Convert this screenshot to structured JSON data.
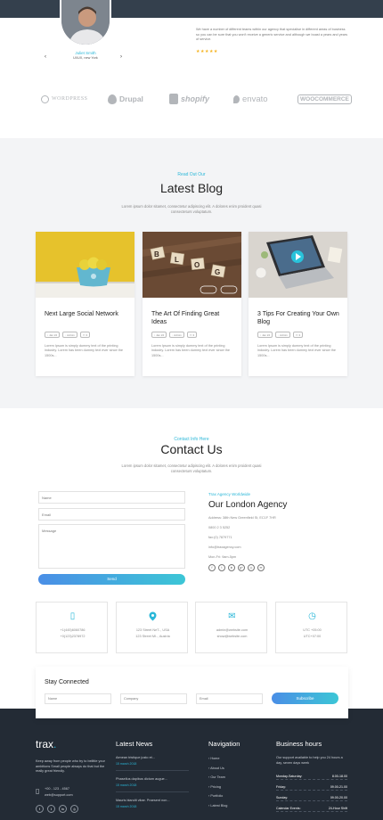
{
  "testimonial": {
    "name": "Juliet Smith",
    "role": "UI/UX, new York",
    "prev_arrow": "‹",
    "next_arrow": "›",
    "quote": "We have a number of different teams within our agency that specialise in different areas of business so you can be sure that you won't receive a generic service and although we boast a years and years of service.",
    "stars": "★★★★★",
    "rating": 5
  },
  "brands": [
    "WordPress",
    "Drupal",
    "shopify",
    "envato",
    "WooCommerce"
  ],
  "blog": {
    "subtitle": "Read Out Our",
    "title": "Latest Blog",
    "description": "Lorem ipsum dolor sitamet, consectetur adipiscing elit. A dolores enim proident quasi consecteturs voluptatum.",
    "posts": [
      {
        "title": "Next Large Social Network",
        "meta": [
          "Jan 24",
          "Admin",
          "3"
        ],
        "excerpt": "Lorem Ipsum is simply dummy text of the printing industry. Lorem has been dummy text ever since the 1500s..."
      },
      {
        "title": "The Art Of Finding Great Ideas",
        "meta": [
          "Jan 24",
          "Admin",
          "3"
        ],
        "excerpt": "Lorem Ipsum is simply dummy text of the printing industry. Lorem has been dummy text ever since the 1500s..."
      },
      {
        "title": "3 Tips For Creating Your Own Blog",
        "meta": [
          "Jan 24",
          "Admin",
          "3"
        ],
        "excerpt": "Lorem Ipsum is simply dummy text of the printing industry. Lorem has been dummy text ever since the 1500s..."
      }
    ]
  },
  "contact": {
    "subtitle": "Contact Info Here",
    "title": "Contact Us",
    "description": "Lorem ipsum dolor sitamet, consectetur adipiscing elit. A dolores enim proident quasi consecteturs voluptatum.",
    "form": {
      "name_placeholder": "Name",
      "email_placeholder": "Email",
      "message_placeholder": "Message",
      "send_label": "Send"
    },
    "agency": {
      "subtitle": "Trax Agency Worldwide",
      "title": "Our London Agency",
      "address": "Address: 38th New Greenfield St, EC1F 7HR",
      "phone1": "0800 2 3 5252",
      "phone2": "fax:(0) 7879771",
      "email": "info@traxagency.com",
      "hours": "Mon-Fri: 9am-5pm"
    },
    "social_icons": [
      "f",
      "t",
      "in",
      "g+",
      "◎",
      "✉"
    ]
  },
  "info_boxes": [
    {
      "icon": "phone-icon",
      "glyph": "▯",
      "line1": "+1(445)6060786",
      "line2": "+0(123)2378972"
    },
    {
      "icon": "location-icon",
      "glyph": "⬤",
      "line1": "123 Street NeT.., USA",
      "line2": "123 Street Ml.., Austria"
    },
    {
      "icon": "mail-icon",
      "glyph": "✉",
      "line1": "admin@website.com",
      "line2": "show@website.com"
    },
    {
      "icon": "clock-icon",
      "glyph": "◷",
      "line1": "UTC +05:00",
      "line2": "UTC+07:00"
    }
  ],
  "newsletter": {
    "title": "Stay Connected",
    "name_placeholder": "Name",
    "company_placeholder": "Company",
    "email_placeholder": "Email",
    "button": "Subscribe"
  },
  "footer": {
    "logo_text": "trax",
    "logo_dot": ".",
    "about": "Keep away from people who try to belittle your ambitions Small people always do that but the really great friendly.",
    "phone": "+00 - 123 - 4567",
    "email": "web@support.com",
    "news_heading": "Latest News",
    "news": [
      {
        "title": "Aenean tristique justo et...",
        "date": "15 march 2018"
      },
      {
        "title": "Phasellus dapibus dictum augue...",
        "date": "15 march 2018"
      },
      {
        "title": "Mauris blandit vitae. Praesent non...",
        "date": "15 march 2018"
      }
    ],
    "nav_heading": "Navigation",
    "nav": [
      "Home",
      "About Us",
      "Our Team",
      "Pricing",
      "Portfolio",
      "Latest Blog"
    ],
    "hours_heading": "Business hours",
    "hours_intro": "Our support available to help you 24 hours a day, seven days week",
    "hours": [
      {
        "day": "Monday-Saturday:",
        "time": "8.00-18.00"
      },
      {
        "day": "Friday:",
        "time": "09.00-21.00"
      },
      {
        "day": "Sunday:",
        "time": "09.00-20.00"
      },
      {
        "day": "Calendar Events:",
        "time": "24-Hour Shift"
      }
    ],
    "social": [
      "f",
      "t",
      "in",
      "◎"
    ]
  },
  "colors": {
    "accent": "#2ab7d8",
    "footer_bg": "#232b35",
    "section_bg": "#f3f4f6"
  }
}
